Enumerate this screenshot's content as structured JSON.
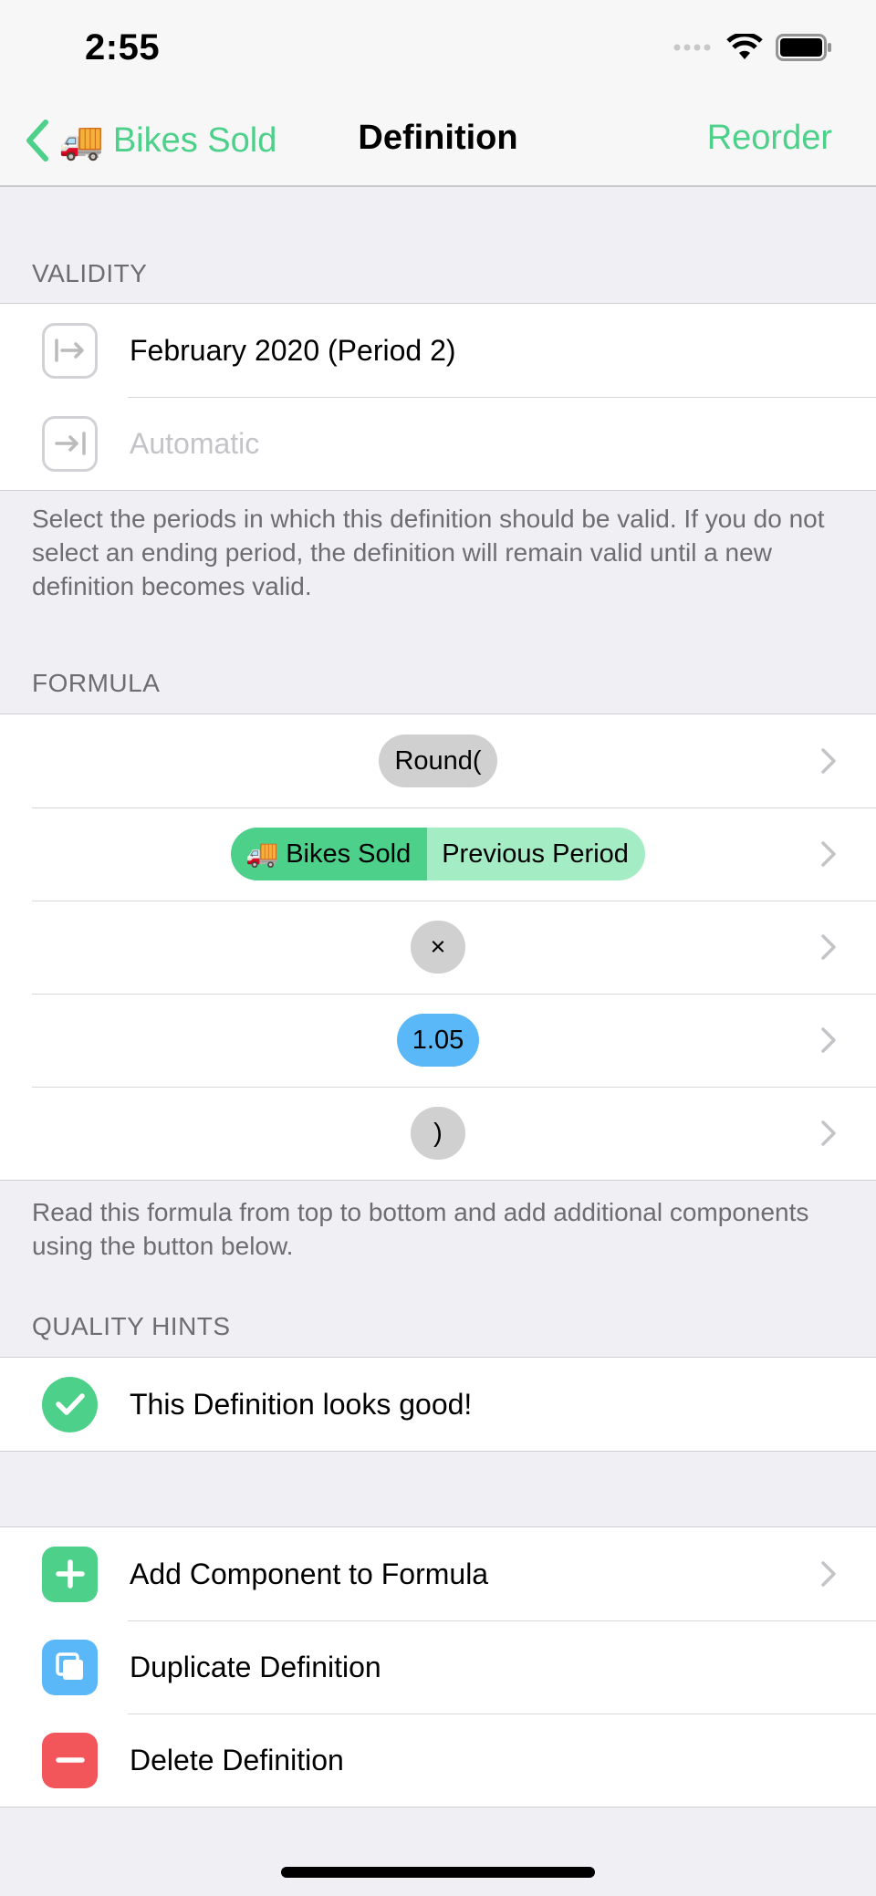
{
  "status_bar": {
    "time": "2:55"
  },
  "nav": {
    "back_emoji": "🚚",
    "back_label": "Bikes Sold",
    "title": "Definition",
    "right_button": "Reorder"
  },
  "validity": {
    "header": "VALIDITY",
    "start_value": "February 2020 (Period 2)",
    "end_placeholder": "Automatic",
    "footer": "Select the periods in which this definition should be valid. If you do not select an ending period, the definition will remain valid until a new definition becomes valid."
  },
  "formula": {
    "header": "FORMULA",
    "components": [
      {
        "label": "Round("
      },
      {
        "emoji": "🚚",
        "label": "Bikes Sold",
        "modifier": "Previous Period"
      },
      {
        "label": "×"
      },
      {
        "label": "1.05"
      },
      {
        "label": ")"
      }
    ],
    "footer": "Read this formula from top to bottom and add additional components using the button below."
  },
  "quality": {
    "header": "QUALITY HINTS",
    "hint": "This Definition looks good!"
  },
  "actions": {
    "add": "Add Component to Formula",
    "duplicate": "Duplicate Definition",
    "delete": "Delete Definition"
  },
  "colors": {
    "accent": "#4cd08a",
    "number_pill": "#5ab7f8",
    "delete": "#f2555a",
    "duplicate": "#5ab7f8"
  }
}
